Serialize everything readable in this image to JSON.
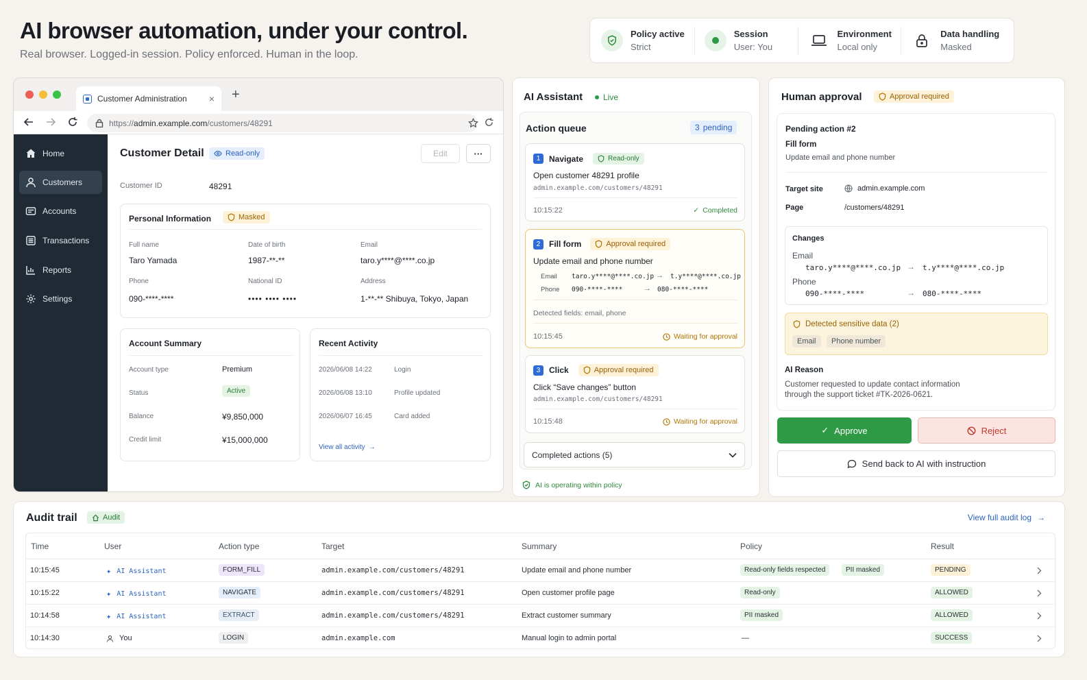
{
  "header": {
    "title": "AI browser automation, under your control.",
    "subtitle": "Real browser. Logged-in session. Policy enforced. Human in the loop."
  },
  "status": [
    {
      "title": "Policy active",
      "value": "Strict",
      "icon": "shield-check-icon"
    },
    {
      "title": "Session",
      "value": "User: You",
      "icon": "green-dot-icon"
    },
    {
      "title": "Environment",
      "value": "Local only",
      "icon": "laptop-icon"
    },
    {
      "title": "Data handling",
      "value": "Masked",
      "icon": "lock-icon"
    }
  ],
  "browser": {
    "tab_title": "Customer Administration",
    "url_prefix": "https://",
    "url_host": "admin.example.com",
    "url_path": "/customers/48291",
    "nav": [
      "Home",
      "Customers",
      "Accounts",
      "Transactions",
      "Reports",
      "Settings"
    ],
    "page_title": "Customer Detail",
    "readonly_badge": "Read-only",
    "edit_label": "Edit",
    "more_label": "···",
    "customer_id_label": "Customer ID",
    "customer_id": "48291",
    "personal": {
      "title": "Personal Information",
      "badge": "Masked",
      "full_name_label": "Full name",
      "full_name": "Taro Yamada",
      "dob_label": "Date of birth",
      "dob": "1987-**-**",
      "email_label": "Email",
      "email": "taro.y****@****.co.jp",
      "phone_label": "Phone",
      "phone": "090-****-****",
      "national_id_label": "National ID",
      "national_id": "•••• •••• ••••",
      "address_label": "Address",
      "address": "1-**-** Shibuya, Tokyo, Japan"
    },
    "account": {
      "title": "Account Summary",
      "type_label": "Account type",
      "type": "Premium",
      "status_label": "Status",
      "status": "Active",
      "balance_label": "Balance",
      "balance": "¥9,850,000",
      "credit_label": "Credit limit",
      "credit": "¥15,000,000"
    },
    "activity": {
      "title": "Recent Activity",
      "items": [
        {
          "time": "2026/06/08 14:22",
          "event": "Login"
        },
        {
          "time": "2026/06/08 13:10",
          "event": "Profile updated"
        },
        {
          "time": "2026/06/07 16:45",
          "event": "Card added"
        }
      ],
      "view_all": "View all activity"
    }
  },
  "assistant": {
    "title": "AI Assistant",
    "live": "Live",
    "queue_title": "Action queue",
    "pending_count": "3",
    "pending_label": "pending",
    "items": [
      {
        "num": "1",
        "action": "Navigate",
        "badge": "Read-only",
        "desc": "Open customer 48291 profile",
        "url": "admin.example.com/customers/48291",
        "time": "10:15:22",
        "status": "Completed"
      },
      {
        "num": "2",
        "action": "Fill form",
        "badge": "Approval required",
        "desc": "Update email and phone number",
        "email_label": "Email",
        "email_from": "taro.y****@****.co.jp",
        "email_to": "t.y****@****.co.jp",
        "phone_label": "Phone",
        "phone_from": "090-****-****",
        "phone_to": "080-****-****",
        "detected": "Detected fields: email, phone",
        "time": "10:15:45",
        "status": "Waiting for approval"
      },
      {
        "num": "3",
        "action": "Click",
        "badge": "Approval required",
        "desc": "Click “Save changes” button",
        "url": "admin.example.com/customers/48291",
        "time": "10:15:48",
        "status": "Waiting for approval"
      }
    ],
    "completed_actions": "Completed actions (5)",
    "policy_note": "AI is operating within policy"
  },
  "approval": {
    "title": "Human approval",
    "badge": "Approval required",
    "pending_title": "Pending action #2",
    "action": "Fill form",
    "action_desc": "Update email and phone number",
    "target_label": "Target site",
    "target": "admin.example.com",
    "page_label": "Page",
    "page": "/customers/48291",
    "changes_title": "Changes",
    "email_label": "Email",
    "email_from": "taro.y****@****.co.jp",
    "email_to": "t.y****@****.co.jp",
    "phone_label": "Phone",
    "phone_from": "090-****-****",
    "phone_to": "080-****-****",
    "sensitive_title": "Detected sensitive data (2)",
    "sensitive_tags": [
      "Email",
      "Phone number"
    ],
    "reason_title": "AI Reason",
    "reason_line1": "Customer requested to update contact information",
    "reason_line2": "through the support ticket #TK-2026-0621.",
    "approve": "Approve",
    "reject": "Reject",
    "send_back": "Send back to AI with instruction"
  },
  "audit": {
    "title": "Audit trail",
    "badge": "Audit",
    "view_full": "View full audit log",
    "columns": [
      "Time",
      "User",
      "Action type",
      "Target",
      "Summary",
      "Policy",
      "Result"
    ],
    "rows": [
      {
        "time": "10:15:45",
        "user": "AI Assistant",
        "action": "FORM_FILL",
        "target": "admin.example.com/customers/48291",
        "summary": "Update email and phone number",
        "policy": [
          "Read-only fields respected",
          "PII masked"
        ],
        "result": "PENDING"
      },
      {
        "time": "10:15:22",
        "user": "AI Assistant",
        "action": "NAVIGATE",
        "target": "admin.example.com/customers/48291",
        "summary": "Open customer profile page",
        "policy": [
          "Read-only"
        ],
        "result": "ALLOWED"
      },
      {
        "time": "10:14:58",
        "user": "AI Assistant",
        "action": "EXTRACT",
        "target": "admin.example.com/customers/48291",
        "summary": "Extract customer summary",
        "policy": [
          "PII masked"
        ],
        "result": "ALLOWED"
      },
      {
        "time": "10:14:30",
        "user": "You",
        "action": "LOGIN",
        "target": "admin.example.com",
        "summary": "Manual login to admin portal",
        "policy_text": "—",
        "result": "SUCCESS"
      }
    ]
  },
  "colors": {
    "accent_blue": "#2f6bd6",
    "approve_green": "#2f9a45",
    "reject_red": "#d0453a",
    "amber": "#e0a12b",
    "sidebar": "#1f2a35"
  }
}
